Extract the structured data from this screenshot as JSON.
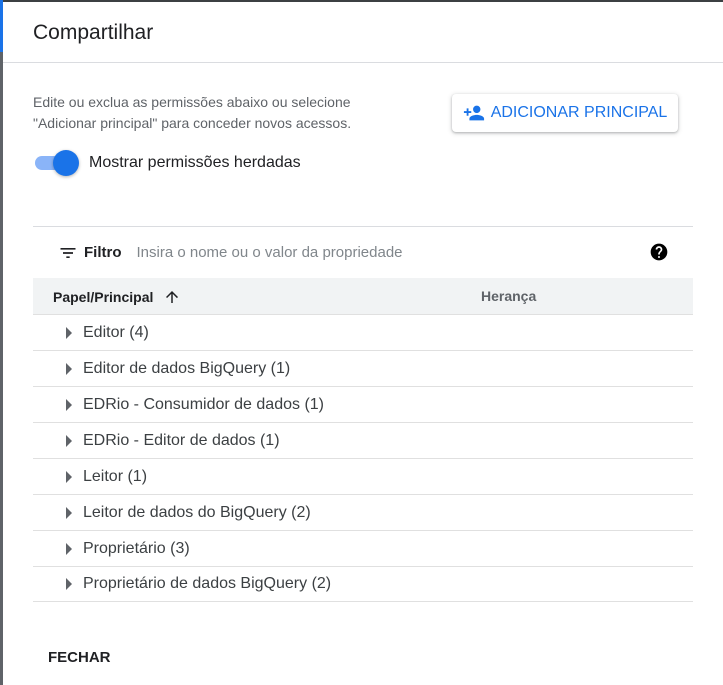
{
  "dialog": {
    "title": "Compartilhar",
    "description": "Edite ou exclua as permissões abaixo ou selecione \"Adicionar principal\" para conceder novos acessos.",
    "add_button_label": "ADICIONAR PRINCIPAL",
    "toggle": {
      "label": "Mostrar permissões herdadas",
      "checked": true
    },
    "close_label": "FECHAR"
  },
  "filter": {
    "label": "Filtro",
    "placeholder": "Insira o nome ou o valor da propriedade"
  },
  "table": {
    "columns": [
      "Papel/Principal",
      "Herança"
    ],
    "rows": [
      {
        "label": "Editor (4)"
      },
      {
        "label": "Editor de dados BigQuery (1)"
      },
      {
        "label": "EDRio - Consumidor de dados (1)"
      },
      {
        "label": "EDRio - Editor de dados (1)"
      },
      {
        "label": "Leitor (1)"
      },
      {
        "label": "Leitor de dados do BigQuery (2)"
      },
      {
        "label": "Proprietário (3)"
      },
      {
        "label": "Proprietário de dados BigQuery (2)"
      }
    ]
  },
  "icons": {
    "add_person": "person-add-icon",
    "filter": "filter-list-icon",
    "help": "help-circle-icon",
    "sort": "arrow-up-icon",
    "expand": "caret-right-icon"
  },
  "colors": {
    "accent": "#1a73e8",
    "toggle_track": "#8ab4f8",
    "header_bg": "#f1f3f4"
  }
}
